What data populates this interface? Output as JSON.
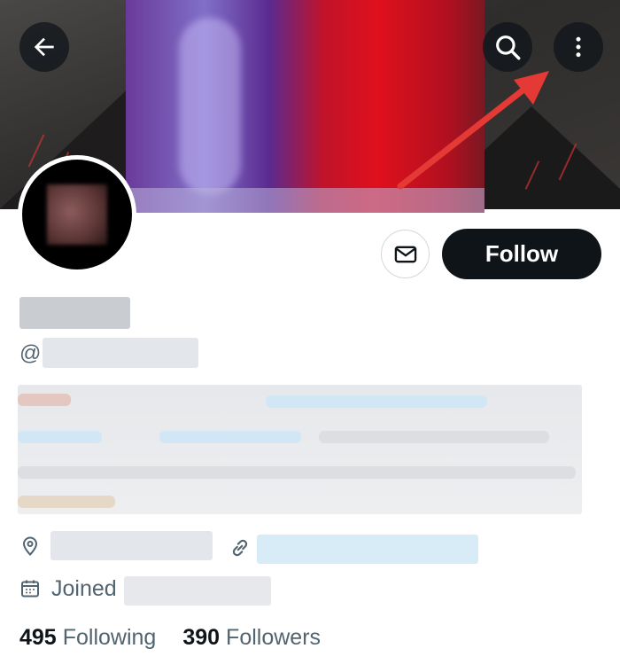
{
  "profile": {
    "handle_prefix": "@",
    "joined_label": "Joined",
    "follow_label": "Follow",
    "stats": {
      "following_count": "495",
      "following_label": "Following",
      "followers_count": "390",
      "followers_label": "Followers"
    }
  },
  "icons": {
    "back": "arrow-left-icon",
    "search": "search-icon",
    "more": "more-vertical-icon",
    "message": "envelope-icon",
    "location": "location-pin-icon",
    "link": "link-icon",
    "calendar": "calendar-icon"
  },
  "colors": {
    "annotation_arrow": "#e53935",
    "follow_button_bg": "#0f1419",
    "secondary_text": "#536471",
    "link_redaction": "#d8ecf7"
  }
}
